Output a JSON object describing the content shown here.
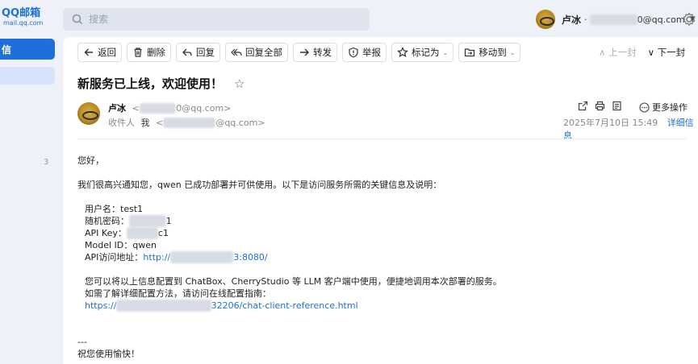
{
  "app": {
    "logo_text": "QQ邮箱",
    "logo_sub": "mail.qq.com"
  },
  "search": {
    "placeholder": "搜索"
  },
  "user": {
    "name": "卢冰",
    "separator": "·",
    "email_prefix": "",
    "email_suffix": "0@qq.com"
  },
  "nav": {
    "compose_label": "信",
    "count": "3"
  },
  "toolbar": {
    "back": "返回",
    "delete": "删除",
    "reply": "回复",
    "reply_all": "回复全部",
    "forward": "转发",
    "report": "举报",
    "mark_as": "标记为",
    "move_to": "移动到",
    "prev": "上一封",
    "next": "下一封"
  },
  "mail": {
    "subject": "新服务已上线，欢迎使用！",
    "from_name": "卢冰",
    "from_addr_suffix": "0@qq.com>",
    "from_addr_prefix": "<",
    "to_label": "收件人",
    "to_name": "我",
    "to_addr_prefix": "<",
    "to_addr_suffix": "@qq.com>",
    "date": "2025年7月10日 15:49",
    "details": "详细信息",
    "more_actions": "更多操作",
    "body": {
      "greeting": "您好，",
      "intro": "我们很高兴通知您，qwen 已成功部署并可供使用。以下是访问服务所需的关键信息及说明：",
      "username_label": "用户名：",
      "username": "test1",
      "password_label": "随机密码：",
      "password_tail": "1",
      "apikey_label": "API Key：",
      "apikey_tail": "c1",
      "model_label": "Model ID：",
      "model": "qwen",
      "api_url_label": "API访问地址：",
      "api_url_prefix": "http://",
      "api_url_suffix": "3:8080/",
      "client_note": "您可以将以上信息配置到 ChatBox、CherryStudio 等 LLM 客户端中使用，便捷地调用本次部署的服务。",
      "guide_note": "如需了解详细配置方法，请访问在线配置指南：",
      "guide_prefix": "https://",
      "guide_suffix": "32206/chat-client-reference.html",
      "sig_dash": "---",
      "closing": "祝您使用愉快！"
    }
  },
  "colors": {
    "accent": "#1e6fd9",
    "link": "#1e6fd9",
    "muted": "#888888"
  }
}
